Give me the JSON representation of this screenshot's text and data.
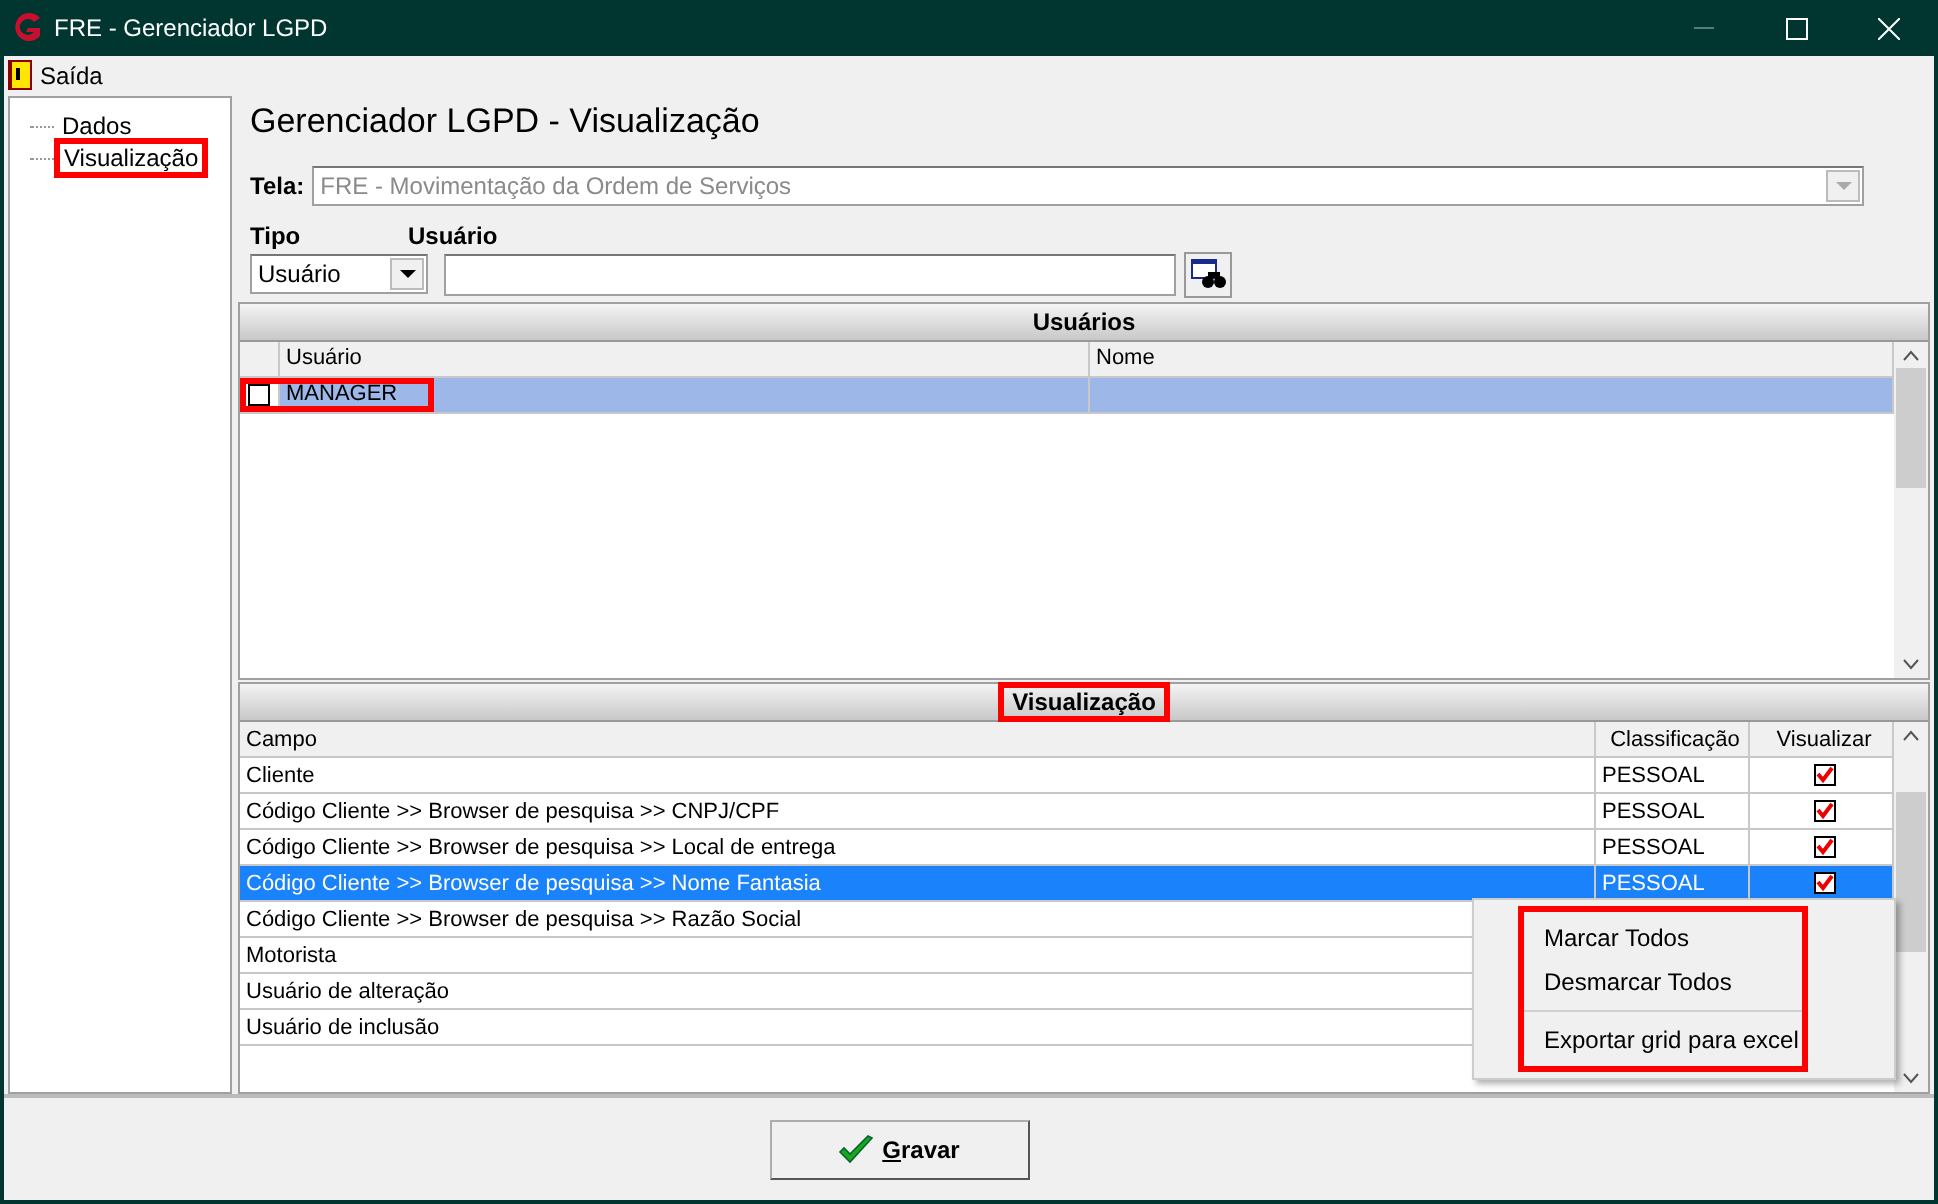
{
  "window": {
    "title": "FRE - Gerenciador LGPD"
  },
  "menu": [
    {
      "label": "Saída"
    }
  ],
  "sidebar": {
    "items": [
      {
        "label": "Dados",
        "highlighted": false
      },
      {
        "label": "Visualização",
        "highlighted": true
      }
    ]
  },
  "heading": "Gerenciador LGPD - Visualização",
  "tela": {
    "label": "Tela:",
    "value": "FRE - Movimentação da Ordem de Serviços",
    "disabled": true
  },
  "tipo": {
    "label": "Tipo",
    "value": "Usuário"
  },
  "usuario": {
    "label": "Usuário"
  },
  "users_panel": {
    "title": "Usuários",
    "highlighted": false,
    "columns": [
      "Usuário",
      "Nome"
    ],
    "rows": [
      {
        "usuario": "MANAGER",
        "checked": false,
        "selected": true,
        "highlighted": true
      }
    ]
  },
  "view_panel": {
    "title": "Visualização",
    "highlighted": true,
    "columns": [
      "Campo",
      "Classificação",
      "Visualizar"
    ],
    "rows": [
      {
        "campo": "Cliente",
        "classificacao": "PESSOAL",
        "visualizar": true,
        "selected": false
      },
      {
        "campo": "Código Cliente >> Browser de pesquisa >> CNPJ/CPF",
        "classificacao": "PESSOAL",
        "visualizar": true,
        "selected": false
      },
      {
        "campo": "Código Cliente >> Browser de pesquisa >> Local de entrega",
        "classificacao": "PESSOAL",
        "visualizar": true,
        "selected": false
      },
      {
        "campo": "Código Cliente >> Browser de pesquisa >> Nome Fantasia",
        "classificacao": "PESSOAL",
        "visualizar": true,
        "selected": true
      },
      {
        "campo": "Código Cliente >> Browser de pesquisa >> Razão Social",
        "selected": false
      },
      {
        "campo": "Motorista",
        "selected": false
      },
      {
        "campo": "Usuário de alteração",
        "selected": false
      },
      {
        "campo": "Usuário de inclusão",
        "selected": false
      }
    ]
  },
  "context_menu": {
    "highlighted": true,
    "items": [
      {
        "kind": "item",
        "label": "Marcar Todos"
      },
      {
        "kind": "item",
        "label": "Desmarcar Todos"
      },
      {
        "kind": "separator"
      },
      {
        "kind": "item",
        "label": "Exportar grid para excel"
      }
    ]
  },
  "save_button": {
    "label": "Gravar"
  }
}
